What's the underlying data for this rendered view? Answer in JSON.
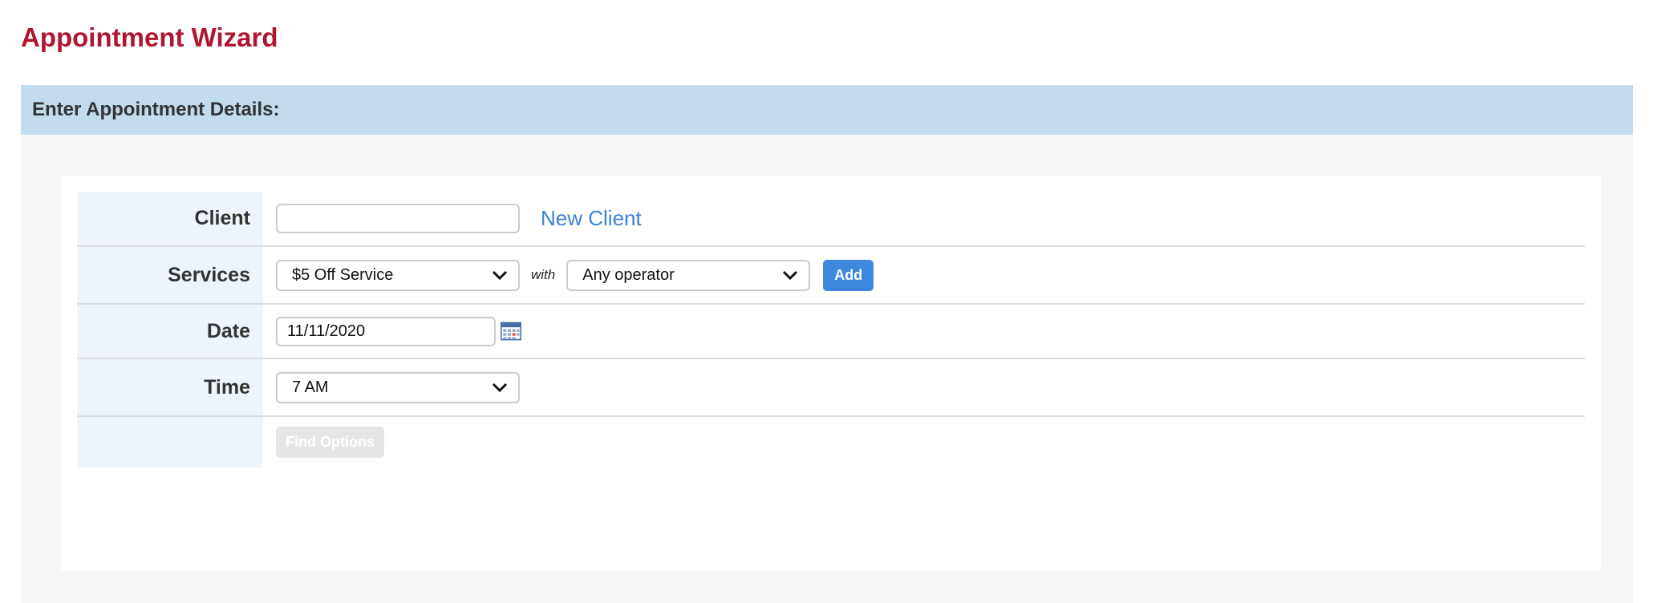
{
  "page": {
    "title": "Appointment Wizard",
    "section_header": "Enter Appointment Details:"
  },
  "form": {
    "client": {
      "label": "Client",
      "value": "",
      "new_client_link": "New Client"
    },
    "services": {
      "label": "Services",
      "service_selected": "$5 Off Service",
      "with_label": "with",
      "operator_selected": "Any operator",
      "add_button": "Add"
    },
    "date": {
      "label": "Date",
      "value": "11/11/2020",
      "calendar_icon": "calendar-icon"
    },
    "time": {
      "label": "Time",
      "selected": "7 AM"
    },
    "find_options_button": "Find Options"
  },
  "colors": {
    "title": "#b0172f",
    "section_header_bg": "#c2dbed",
    "label_cell_bg": "#edf4fb",
    "link": "#3b82d6",
    "primary_button": "#3d88dd",
    "disabled_button": "#e6e6e6"
  }
}
